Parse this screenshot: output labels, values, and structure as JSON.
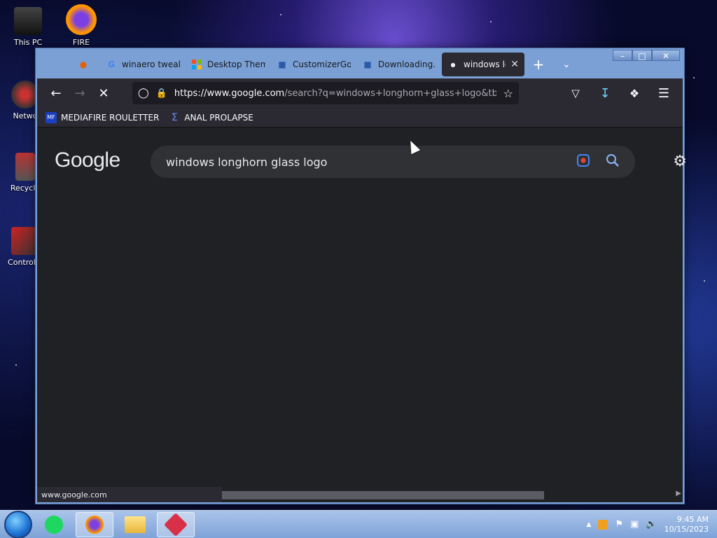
{
  "desktop": {
    "icons": [
      {
        "label": "This PC"
      },
      {
        "label": "FIRE"
      },
      {
        "label": "Netwo"
      },
      {
        "label": "Recycle"
      },
      {
        "label": "Control P"
      }
    ]
  },
  "browser": {
    "tabs": [
      {
        "label": "",
        "icon": "firefox-icon"
      },
      {
        "label": "winaero tweak",
        "icon": "google-icon"
      },
      {
        "label": "Desktop Them",
        "icon": "windows-icon"
      },
      {
        "label": "CustomizerGo",
        "icon": "customizer-icon"
      },
      {
        "label": "Downloading...",
        "icon": "download-page-icon"
      },
      {
        "label": "windows lo",
        "icon": "loading-icon",
        "active": true
      }
    ],
    "address": "https://www.google.com/search?q=windows+longhorn+glass+logo&tbm=",
    "address_host": "https://www.google.com",
    "address_rest": "/search?q=windows+longhorn+glass+logo&tbm=",
    "bookmarks": [
      {
        "label": "MEDIAFIRE ROULETTER",
        "icon": "MF T"
      },
      {
        "label": "ANAL PROLAPSE",
        "icon": "sigma"
      }
    ],
    "status_url": "www.google.com"
  },
  "page": {
    "logo": "Google",
    "search_query": "windows longhorn glass logo"
  },
  "taskbar": {
    "time": "9:45 AM",
    "date": "10/15/2023"
  },
  "colors": {
    "browser_chrome": "#2b2a33",
    "page_bg": "#202124",
    "searchbox_bg": "#303134",
    "window_frame": "#7aa0d6"
  }
}
